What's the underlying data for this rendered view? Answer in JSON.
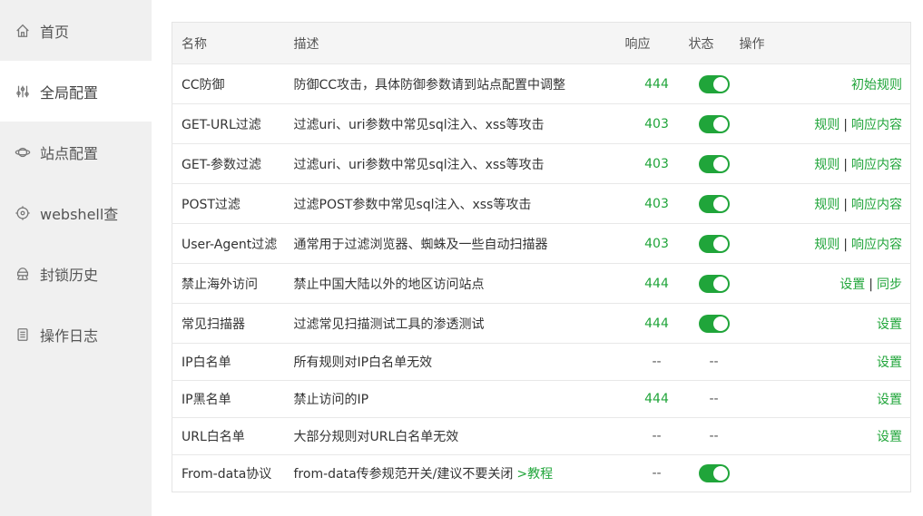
{
  "sidebar": {
    "items": [
      {
        "label": "首页",
        "icon": "home-icon"
      },
      {
        "label": "全局配置",
        "icon": "sliders-icon"
      },
      {
        "label": "站点配置",
        "icon": "planet-icon"
      },
      {
        "label": "webshell查",
        "icon": "crosshair-icon"
      },
      {
        "label": "封锁历史",
        "icon": "history-icon"
      },
      {
        "label": "操作日志",
        "icon": "log-icon"
      }
    ],
    "active_index": 1
  },
  "table": {
    "headers": {
      "name": "名称",
      "desc": "描述",
      "code": "响应",
      "status": "状态",
      "ops": "操作"
    },
    "rows": [
      {
        "name": "CC防御",
        "desc": "防御CC攻击，具体防御参数请到站点配置中调整",
        "code": "444",
        "status": "on",
        "ops": [
          "初始规则"
        ]
      },
      {
        "name": "GET-URL过滤",
        "desc": "过滤uri、uri参数中常见sql注入、xss等攻击",
        "code": "403",
        "status": "on",
        "ops": [
          "规则",
          "响应内容"
        ]
      },
      {
        "name": "GET-参数过滤",
        "desc": "过滤uri、uri参数中常见sql注入、xss等攻击",
        "code": "403",
        "status": "on",
        "ops": [
          "规则",
          "响应内容"
        ]
      },
      {
        "name": "POST过滤",
        "desc": "过滤POST参数中常见sql注入、xss等攻击",
        "code": "403",
        "status": "on",
        "ops": [
          "规则",
          "响应内容"
        ]
      },
      {
        "name": "User-Agent过滤",
        "desc": "通常用于过滤浏览器、蜘蛛及一些自动扫描器",
        "code": "403",
        "status": "on",
        "ops": [
          "规则",
          "响应内容"
        ]
      },
      {
        "name": "禁止海外访问",
        "desc": "禁止中国大陆以外的地区访问站点",
        "code": "444",
        "status": "on",
        "ops": [
          "设置",
          "同步"
        ]
      },
      {
        "name": "常见扫描器",
        "desc": "过滤常见扫描测试工具的渗透测试",
        "code": "444",
        "status": "on",
        "ops": [
          "设置"
        ]
      },
      {
        "name": "IP白名单",
        "desc": "所有规则对IP白名单无效",
        "code": "--",
        "status": "--",
        "ops": [
          "设置"
        ]
      },
      {
        "name": "IP黑名单",
        "desc": "禁止访问的IP",
        "code": "444",
        "status": "--",
        "ops": [
          "设置"
        ]
      },
      {
        "name": "URL白名单",
        "desc": "大部分规则对URL白名单无效",
        "code": "--",
        "status": "--",
        "ops": [
          "设置"
        ]
      },
      {
        "name": "From-data协议",
        "desc": "from-data传参规范开关/建议不要关闭",
        "desc_link": ">教程",
        "code": "--",
        "status": "on",
        "ops": []
      }
    ],
    "op_separator": "|"
  },
  "colors": {
    "accent": "#20a53a",
    "sidebar_bg": "#f0f0f0"
  }
}
